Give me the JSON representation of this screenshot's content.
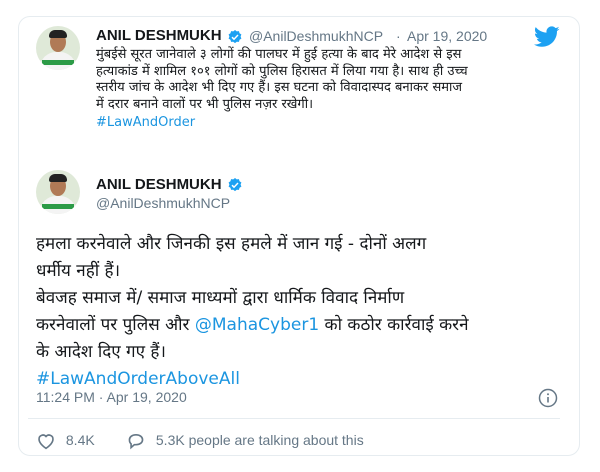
{
  "quoted_tweet": {
    "author_name": "ANIL DESHMUKH",
    "handle": "@AnilDeshmukhNCP",
    "separator": "·",
    "date": "Apr 19, 2020",
    "lines": [
      "मुंबईसे सूरत जानेवाले ३ लोगों की पालघर में हुई हत्या के बाद मेरे आदेश से इस",
      "हत्याकांड में शामिल १०१ लोगों को पुलिस हिरासत में लिया गया है। साथ ही उच्च",
      "स्तरीय जांच के आदेश भी दिए गए हैं।  इस घटना को विवादास्पद बनाकर समाज",
      "में दरार बनाने वालों पर भी पुलिस नज़र रखेगी।"
    ],
    "hashtag": "#LawAndOrder"
  },
  "tweet": {
    "author_name": "ANIL DESHMUKH",
    "handle": "@AnilDeshmukhNCP",
    "line1": "हमला करनेवाले और जिनकी इस हमले में जान गई -  दोनों अलग",
    "line2": "धर्मीय नहीं हैं।",
    "line3": "बेवजह समाज में/ समाज माध्यमों द्वारा धार्मिक विवाद  निर्माण",
    "line4_prefix": "करनेवालों पर पुलिस और ",
    "mention": "@MahaCyber1",
    "line4_suffix": " को कठोर कार्रवाई करने",
    "line5": "के आदेश दिए गए हैं।",
    "hashtag": "#LawAndOrderAboveAll",
    "timestamp": "11:24 PM · Apr 19, 2020",
    "likes": "8.4K",
    "talking": "5.3K people are talking about this"
  },
  "colors": {
    "link": "#1b95e0",
    "muted": "#657786",
    "verified": "#1da1f2",
    "twitter_bird": "#1da1f2"
  },
  "icons": [
    "verified-badge-icon",
    "twitter-bird-icon",
    "info-icon",
    "heart-icon",
    "comment-icon"
  ]
}
